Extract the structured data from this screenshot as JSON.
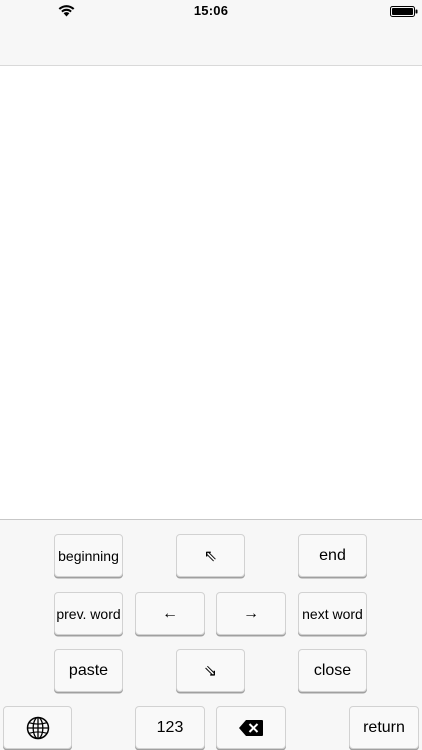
{
  "status_bar": {
    "time": "15:06",
    "icons": [
      "wifi-icon",
      "battery-icon"
    ]
  },
  "keyboard": {
    "row1": {
      "beginning": "beginning",
      "up_left_arrow": "⇖",
      "end": "end"
    },
    "row2": {
      "prev_word": "prev. word",
      "left_arrow": "←",
      "right_arrow": "→",
      "next_word": "next word"
    },
    "row3": {
      "paste": "paste",
      "down_right_arrow": "⇘",
      "close": "close"
    },
    "row4": {
      "globe": "globe-icon",
      "numbers": "123",
      "delete": "delete-icon",
      "return": "return"
    }
  }
}
